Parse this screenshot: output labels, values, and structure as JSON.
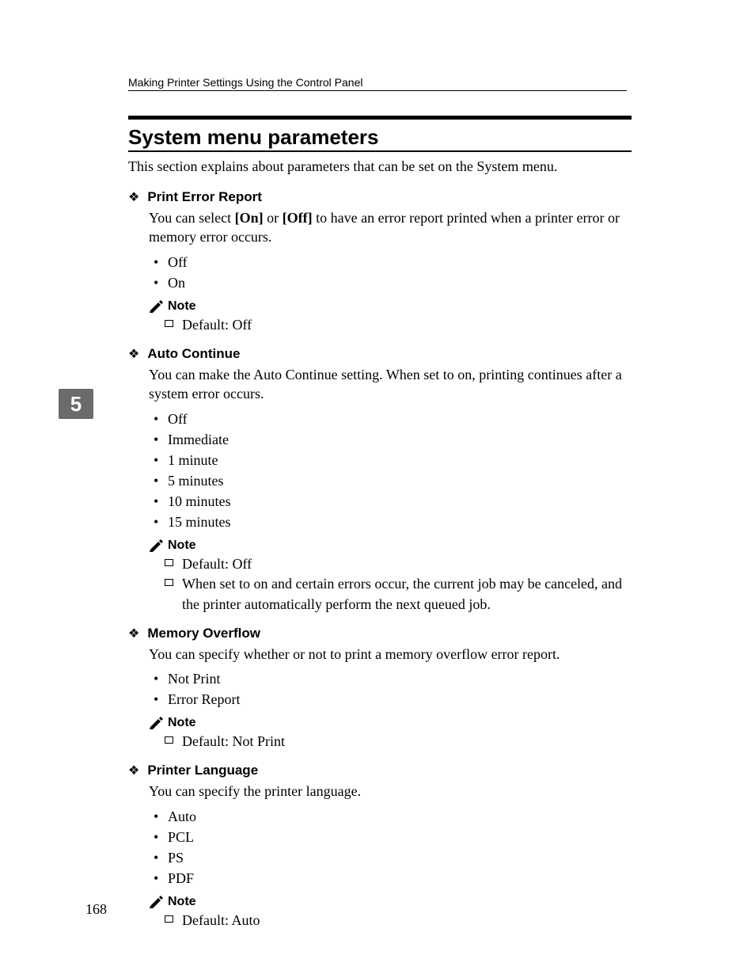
{
  "header": "Making Printer Settings Using the Control Panel",
  "section_title": "System menu parameters",
  "intro": "This section explains about parameters that can be set on the System menu.",
  "chapter_tab": "5",
  "page_number": "168",
  "note_label": "Note",
  "params": {
    "print_error": {
      "title": "Print Error Report",
      "desc_pre": "You can select ",
      "desc_on": "[On]",
      "desc_mid": " or ",
      "desc_off": "[Off]",
      "desc_post": " to have an error report printed when a printer error or memory error occurs.",
      "options": [
        "Off",
        "On"
      ],
      "notes": [
        "Default: Off"
      ]
    },
    "auto_continue": {
      "title": "Auto Continue",
      "desc": "You can make the Auto Continue setting. When set to on, printing continues after a system error occurs.",
      "options": [
        "Off",
        "Immediate",
        "1 minute",
        "5 minutes",
        "10 minutes",
        "15 minutes"
      ],
      "notes": [
        "Default: Off",
        "When set to on and certain errors occur, the current job may be canceled, and the printer automatically perform the next queued job."
      ]
    },
    "memory_overflow": {
      "title": "Memory Overflow",
      "desc": "You can specify whether or not to print a memory overflow error report.",
      "options": [
        "Not Print",
        "Error Report"
      ],
      "notes": [
        "Default: Not Print"
      ]
    },
    "printer_language": {
      "title": "Printer Language",
      "desc": "You can specify the printer language.",
      "options": [
        "Auto",
        "PCL",
        "PS",
        "PDF"
      ],
      "notes": [
        "Default: Auto"
      ]
    }
  }
}
